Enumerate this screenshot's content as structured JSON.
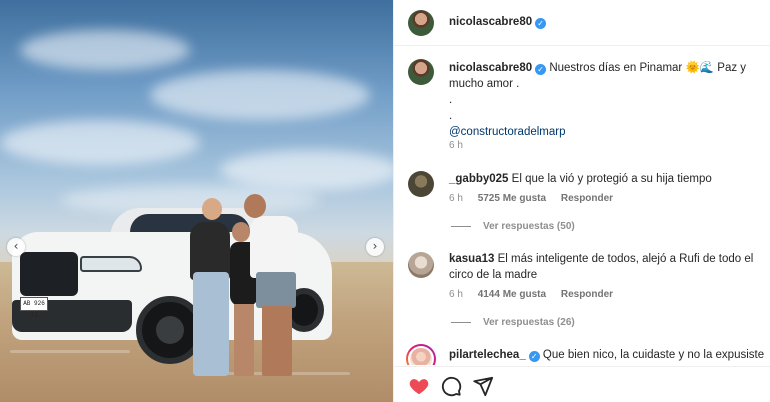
{
  "photo": {
    "plate": "AB 926 JJ",
    "prev_arrow": "‹",
    "next_arrow": "›"
  },
  "header": {
    "username": "nicolascabre80",
    "verified_icon": "✓"
  },
  "caption": {
    "username": "nicolascabre80",
    "text": "Nuestros días en Pinamar 🌞🌊 Paz y mucho amor .",
    "dot1": ".",
    "dot2": ".",
    "mention": "@constructoradelmarp",
    "time": "6 h"
  },
  "comments": [
    {
      "username": "_gabby025",
      "text": "El que la vió y protegió a su hija tiempo",
      "time": "6 h",
      "likes": "5725 Me gusta",
      "reply": "Responder",
      "view_replies": "Ver respuestas (50)"
    },
    {
      "username": "kasua13",
      "text": "El más inteligente de todos, alejó a Rufi de todo el circo de la madre",
      "time": "6 h",
      "likes": "4144 Me gusta",
      "reply": "Responder",
      "view_replies": "Ver respuestas (26)"
    },
    {
      "username": "pilartelechea_",
      "text": "Que bien nico, la cuidaste y no la expusiste en"
    }
  ],
  "colors": {
    "like_red": "#ed4956",
    "verified_blue": "#3897f0",
    "link": "#00376b"
  },
  "icons": [
    "heart-icon",
    "comment-icon",
    "share-icon",
    "verified-icon",
    "chevron-left-icon",
    "chevron-right-icon"
  ]
}
